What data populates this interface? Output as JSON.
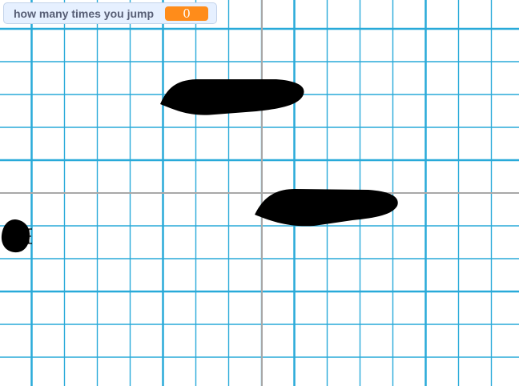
{
  "stage": {
    "background": "graph-paper-grid",
    "grid_color": "#29aad9",
    "axis_color": "#a8a8a8"
  },
  "monitor": {
    "label": "how many times you jump",
    "value": "0",
    "label_color": "#575e75",
    "value_bg": "#ff8c1a"
  },
  "sprites": {
    "platforms": [
      "platform-1",
      "platform-2"
    ],
    "player": "player-ball-sprite",
    "color": "#000000"
  }
}
